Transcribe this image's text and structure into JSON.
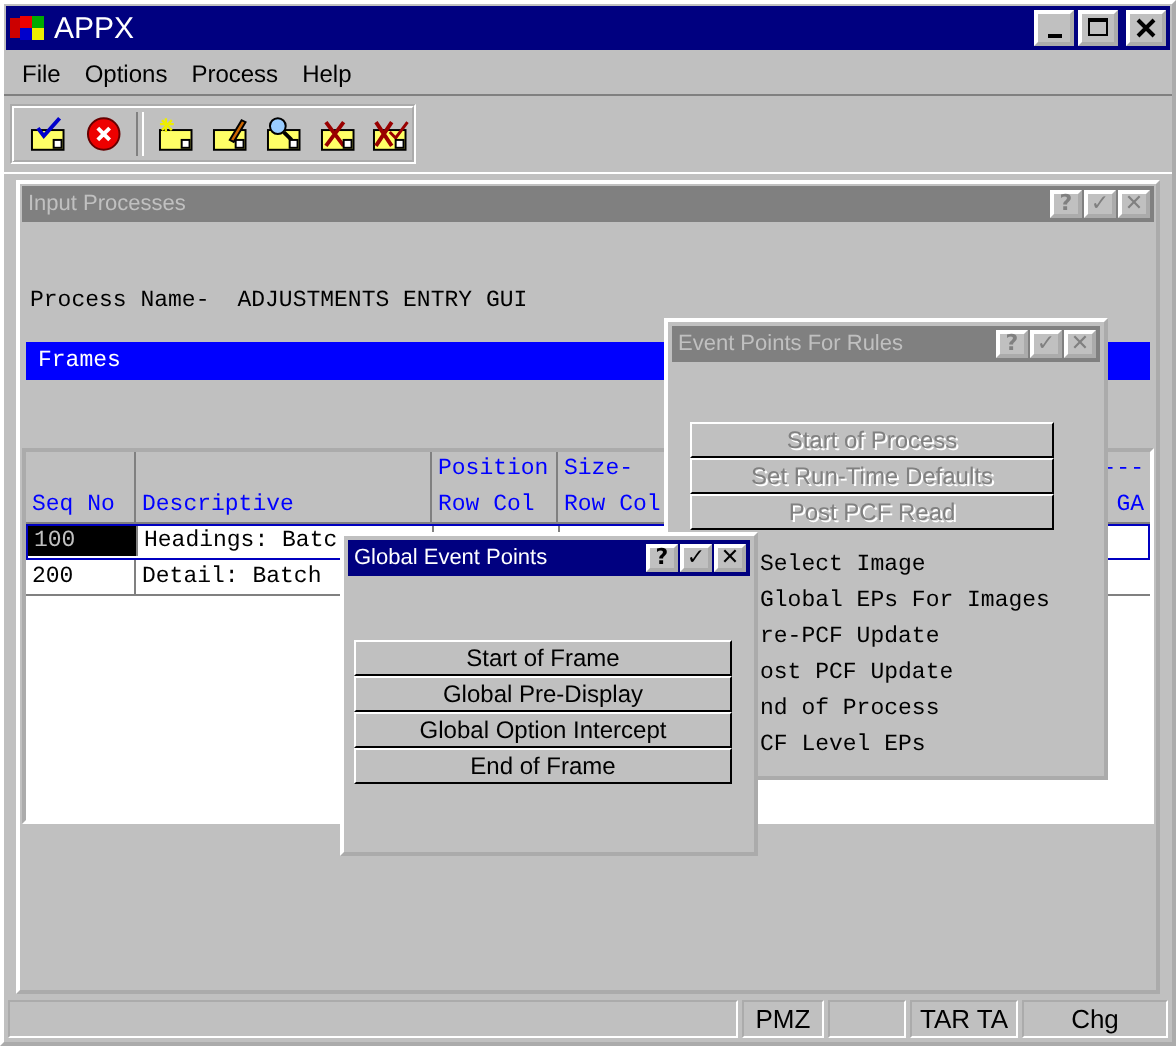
{
  "window": {
    "title": "APPX",
    "active": true
  },
  "menu": [
    {
      "label": "File"
    },
    {
      "label": "Options"
    },
    {
      "label": "Process"
    },
    {
      "label": "Help"
    }
  ],
  "input_processes": {
    "title": "Input Processes",
    "active": false,
    "buttons": [
      "?",
      "✓",
      "✕"
    ],
    "process_label": "Process Name-",
    "process_name": "ADJUSTMENTS ENTRY GUI",
    "section": "Frames",
    "table": {
      "columns": [
        {
          "bottom": "Seq No"
        },
        {
          "bottom": "Descriptive"
        },
        {
          "top": "Position",
          "bottom": "Row Col"
        },
        {
          "top": "Size-",
          "bottom": "Row Col"
        },
        {
          "top": "---",
          "bottom": "GA"
        }
      ],
      "rows": [
        {
          "cells": [
            "100",
            "Headings: Batc"
          ],
          "selected": true
        },
        {
          "cells": [
            "200",
            "Detail: Batch"
          ],
          "selected": false
        }
      ]
    }
  },
  "event_points_dialog": {
    "title": "Event Points For Rules",
    "active": false,
    "buttons": [
      "?",
      "✓",
      "✕"
    ],
    "actions": [
      {
        "label": "Start of Process",
        "disabled": true
      },
      {
        "label": "Set Run-Time Defaults",
        "disabled": true
      },
      {
        "label": "Post PCF Read",
        "disabled": true
      }
    ],
    "items": [
      "Select Image",
      "Global EPs For Images",
      "re-PCF Update",
      "ost PCF Update",
      "nd of Process",
      "CF Level EPs"
    ]
  },
  "global_event_points_dialog": {
    "title": "Global Event Points",
    "active": true,
    "buttons": [
      "?",
      "✓",
      "✕"
    ],
    "actions": [
      {
        "label": "Start of Frame",
        "disabled": false
      },
      {
        "label": "Global Pre-Display",
        "disabled": false
      },
      {
        "label": "Global Option Intercept",
        "disabled": false
      },
      {
        "label": "End of Frame",
        "disabled": false
      }
    ]
  },
  "status_bar": [
    "PMZ",
    "TAR TA",
    "Chg"
  ]
}
